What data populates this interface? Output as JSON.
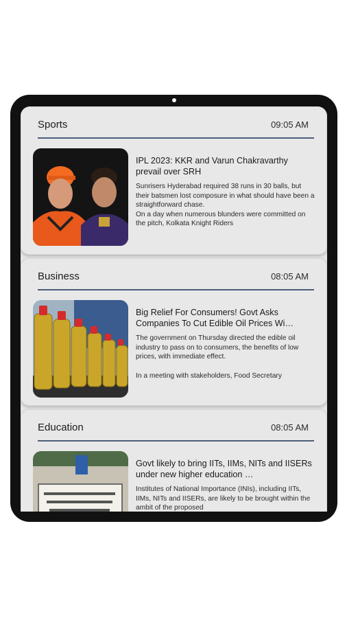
{
  "feed": [
    {
      "category": "Sports",
      "time": "09:05 AM",
      "headline": "IPL 2023: KKR and Varun Chakravarthy prevail over SRH",
      "summary_lines": [
        "Sunrisers Hyderabad required 38 runs in 30 balls, but their batsmen lost composure in what should have been a straightforward chase.",
        "On a day when numerous blunders were committed on the pitch, Kolkata Knight Riders"
      ]
    },
    {
      "category": "Business",
      "time": "08:05 AM",
      "headline": "Big Relief For Consumers! Govt Asks Companies To Cut Edible Oil Prices Wi…",
      "summary_lines": [
        "The government on Thursday directed the edible oil industry to pass on to consumers, the benefits of low prices, with immediate effect.",
        "In a meeting with stakeholders, Food Secretary"
      ]
    },
    {
      "category": "Education",
      "time": "08:05 AM",
      "headline": "Govt likely to bring IITs, IIMs, NITs and IISERs under new higher education …",
      "summary_lines": [
        "Institutes of National Importance (INIs), including IITs, IIMs, NITs and IISERs, are likely to be brought within the ambit of the proposed"
      ]
    }
  ],
  "colors": {
    "divider": "#4b5d78",
    "card_bg": "#e8e8e8",
    "device_frame": "#111111"
  }
}
